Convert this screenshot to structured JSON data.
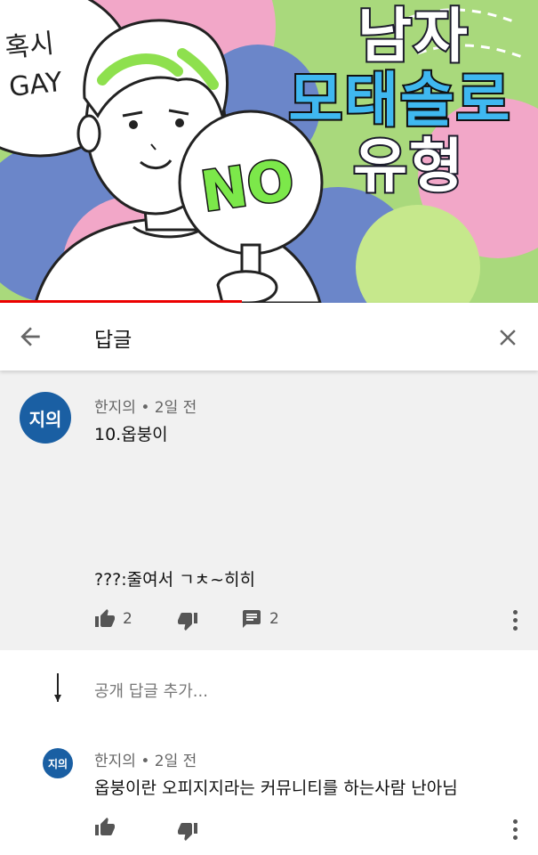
{
  "thumbnail": {
    "bubble_text_1": "혹시",
    "bubble_text_2": "GAY",
    "sign_text": "NO",
    "title_line1": "남자",
    "title_line2": "모태솔로",
    "title_line3": "유형",
    "progress_percent": 45
  },
  "header": {
    "title": "답글"
  },
  "parent_comment": {
    "avatar_text": "지의",
    "author": "한지의",
    "time": "2일 전",
    "text": "10.옵붕이",
    "text_2": "???:줄여서 ㄱㅊ~히히",
    "likes": "2",
    "replies": "2"
  },
  "reply_input": {
    "placeholder": "공개 답글 추가..."
  },
  "reply": {
    "avatar_text": "지의",
    "author": "한지의",
    "time": "2일 전",
    "text": "옵붕이란 오피지지라는 커뮤니티를 하는사람 난아님"
  },
  "colors": {
    "avatar": "#1a5fa3",
    "background": "#f1f1f1",
    "progress": "#ee0000"
  }
}
